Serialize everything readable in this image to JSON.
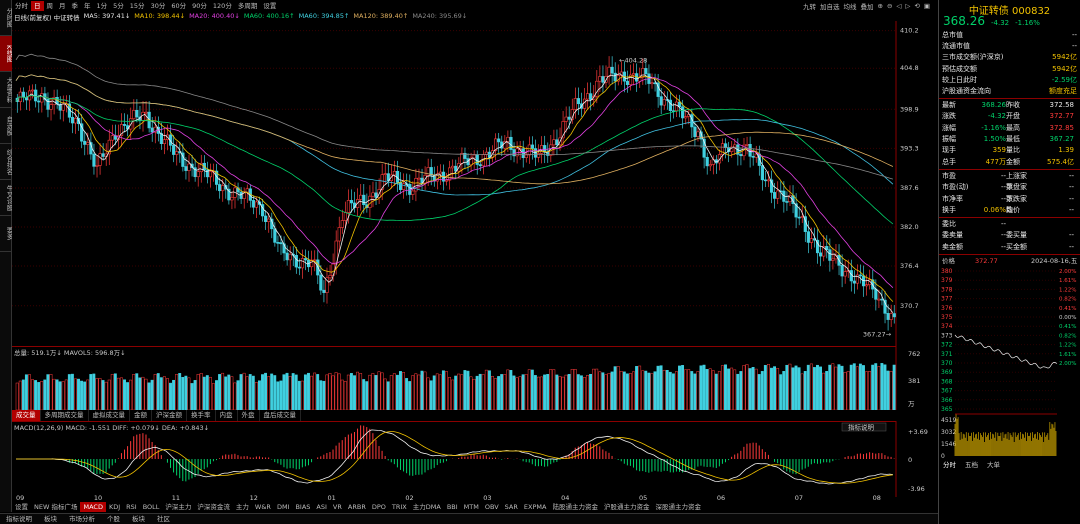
{
  "left_tabs": [
    "分时图",
    "K线图",
    "大盘资料",
    "自选股",
    "综合排名",
    "牛叉诊股",
    "要多"
  ],
  "period_bar": [
    "分时",
    "日",
    "周",
    "月",
    "季",
    "年",
    "1分",
    "5分",
    "15分",
    "30分",
    "60分",
    "90分",
    "120分",
    "多周期",
    "设置"
  ],
  "period_active": "日",
  "tool_bar": [
    "九转",
    "加自选",
    "均线",
    "叠加"
  ],
  "ma_line": {
    "label": "日线(前复权)  中证转债",
    "ma5": "MA5: 397.41↓",
    "ma10": "MA10: 398.44↓",
    "ma20": "MA20: 400.40↓",
    "ma60": "MA60: 400.16↑",
    "ma60b": "MA60: 394.85↑",
    "ma120": "MA120: 389.40↑",
    "ma240": "MA240: 395.69↓"
  },
  "y_axis": [
    "410.2",
    "404.8",
    "398.9",
    "393.3",
    "387.6",
    "382.0",
    "376.4",
    "370.7"
  ],
  "annotations": {
    "high": "404.28",
    "low": "367.27"
  },
  "volume": {
    "title": "总量: 519.1万↓  MAVOL5: 596.8万↓",
    "axis": [
      "762",
      "381",
      "万"
    ]
  },
  "indicator_tabs": [
    "成交量",
    "多周期成交量",
    "虚拟成交量",
    "金额",
    "沪深金额",
    "换手率",
    "内盘",
    "外盘",
    "盘后成交量"
  ],
  "macd": {
    "title": "MACD(12,26,9)  MACD: -1.551  DIFF: +0.079↓  DEA: +0.843↓",
    "axis": [
      "+3.69",
      "0",
      "-3.96"
    ],
    "button": "指标说明"
  },
  "x_axis": [
    "09",
    "10",
    "11",
    "12",
    "01",
    "02",
    "03",
    "04",
    "05",
    "06",
    "07",
    "08"
  ],
  "bottom_tabs": [
    "设置",
    "NEW 指标广场",
    "MACD",
    "KDJ",
    "RSI",
    "BOLL",
    "沪深主力",
    "沪深资金流",
    "主力",
    "W&R",
    "DMI",
    "BIAS",
    "ASI",
    "VR",
    "ARBR",
    "DPO",
    "TRIX",
    "主力DMA",
    "BBI",
    "MTM",
    "OBV",
    "SAR",
    "EXPMA",
    "陆股通主力资金",
    "沪股通主力资金",
    "深股通主力资金"
  ],
  "bottom_active": "MACD",
  "status_bar": [
    "指标说明",
    "板块",
    "市场分析",
    "个股",
    "板块",
    "社区"
  ],
  "right_panel": {
    "title": "中证转债 000832",
    "price": "368.26",
    "change": "-4.32",
    "change_pct": "-1.16%",
    "rows": [
      {
        "label": "总市值",
        "value": "--",
        "color": "white"
      },
      {
        "label": "流通市值",
        "value": "--",
        "color": "white"
      },
      {
        "label": "三市成交额(沪深京)",
        "value": "5942亿",
        "color": "yellow"
      },
      {
        "label": "预估成交额",
        "value": "5942亿",
        "color": "yellow"
      },
      {
        "label": "较上日此时",
        "value": "-2.59亿",
        "color": "green"
      },
      {
        "label": "沪股通资金流向",
        "value": "额度充足",
        "color": "yellow"
      }
    ],
    "quote": [
      [
        "最新",
        "368.26",
        "昨收",
        "372.58"
      ],
      [
        "涨跌",
        "-4.32",
        "开盘",
        "372.77"
      ],
      [
        "涨幅",
        "-1.16%",
        "最高",
        "372.85"
      ],
      [
        "振幅",
        "1.50%",
        "最低",
        "367.27"
      ],
      [
        "现手",
        "359",
        "量比",
        "1.39"
      ],
      [
        "总手",
        "477万",
        "金额",
        "575.4亿"
      ]
    ],
    "stats": [
      [
        "市盈",
        "--",
        "上涨家数",
        "--"
      ],
      [
        "市盈(动)",
        "--",
        "平盘家数",
        "--"
      ],
      [
        "市净率",
        "--",
        "下跌家数",
        "--"
      ],
      [
        "换手",
        "0.06%",
        "均价",
        "--"
      ]
    ],
    "orders": [
      [
        "委比",
        "--",
        "",
        ""
      ],
      [
        "委卖量",
        "--",
        "委买量",
        "--"
      ],
      [
        "卖金额",
        "--",
        "买金额",
        "--"
      ]
    ],
    "intraday": {
      "price_label": "372.77",
      "date": "2024-08-16,五",
      "y_left": [
        "380",
        "379",
        "378",
        "377",
        "376",
        "375",
        "374",
        "373",
        "372",
        "371",
        "370",
        "369",
        "368",
        "367",
        "366",
        "365"
      ],
      "y_right": [
        "2.00%",
        "1.61%",
        "1.22%",
        "0.82%",
        "0.41%",
        "0.00%",
        "0.41%",
        "0.82%",
        "1.22%",
        "1.61%",
        "2.00%"
      ],
      "vol_left": [
        "4519",
        "3032",
        "1546",
        "0"
      ],
      "tabs": [
        "分时",
        "五档",
        "大单"
      ]
    }
  }
}
